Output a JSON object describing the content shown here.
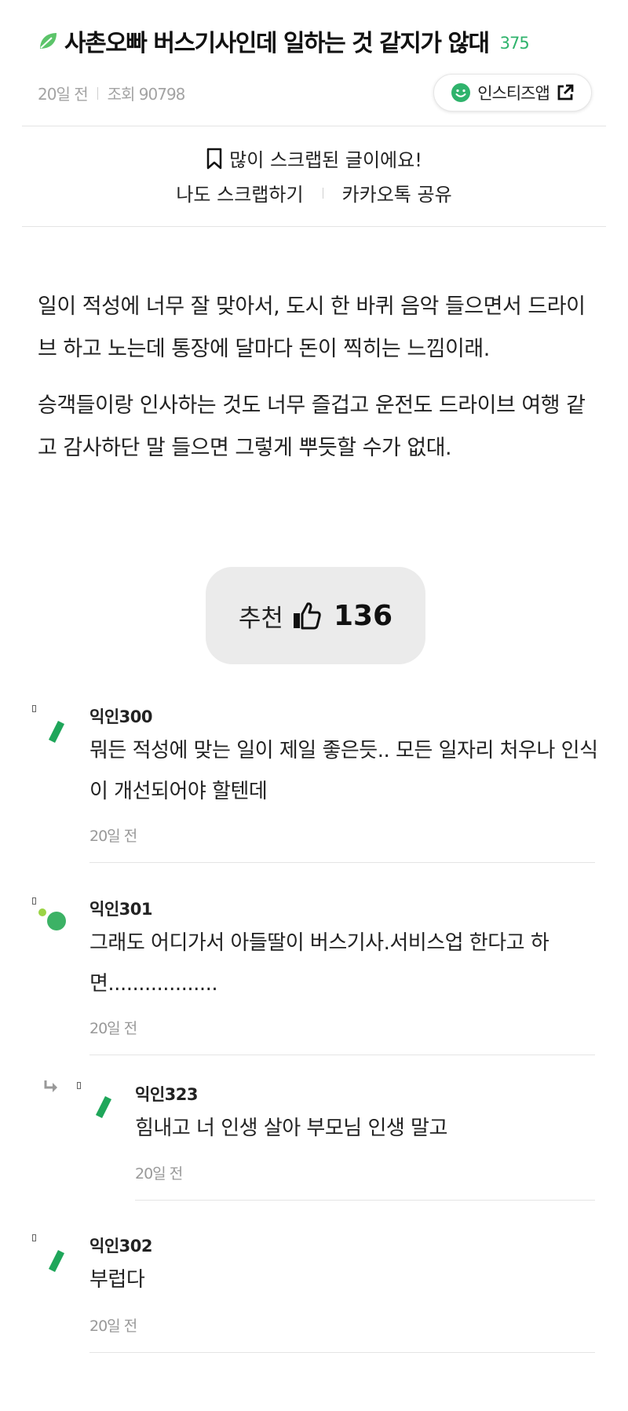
{
  "post": {
    "title": "사촌오빠 버스기사인데 일하는 것 같지가 않대",
    "comment_count": "375",
    "time": "20일 전",
    "views": "조회 90798",
    "app_button_label": "인스티즈앱",
    "scrap_notice": "많이 스크랩된 글이에요!",
    "scrap_action": "나도 스크랩하기",
    "kakao_share": "카카오톡 공유",
    "paragraphs": [
      "일이 적성에 너무 잘 맞아서, 도시 한 바퀴 음악 들으면서 드라이브 하고 노는데 통장에 달마다 돈이 찍히는 느낌이래.",
      "승객들이랑 인사하는 것도 너무 즐겁고 운전도 드라이브 여행 같고 감사하단 말 들으면 그렇게 뿌듯할 수가 없대."
    ],
    "recommend_label": "추천",
    "recommend_count": "136"
  },
  "comments": [
    {
      "name": "익인300",
      "text": "뭐든 적성에 맞는 일이 제일 좋은듯.. 모든 일자리 처우나 인식이 개선되어야 할텐데",
      "time": "20일 전",
      "avatar_icon": "leaf-slash-icon",
      "reply": false
    },
    {
      "name": "익인301",
      "text": "그래도 어디가서 아들딸이 버스기사.서비스업 한다고 하면..................",
      "time": "20일 전",
      "avatar_icon": "green-dots-icon",
      "reply": false
    },
    {
      "name": "익인323",
      "text": "힘내고 너 인생 살아 부모님 인생 말고",
      "time": "20일 전",
      "avatar_icon": "leaf-slash-icon",
      "reply": true
    },
    {
      "name": "익인302",
      "text": "부럽다",
      "time": "20일 전",
      "avatar_icon": "leaf-slash-icon",
      "reply": false
    }
  ],
  "colors": {
    "accent": "#2fb36c",
    "button_bg": "#ebebeb",
    "muted": "#999999"
  }
}
